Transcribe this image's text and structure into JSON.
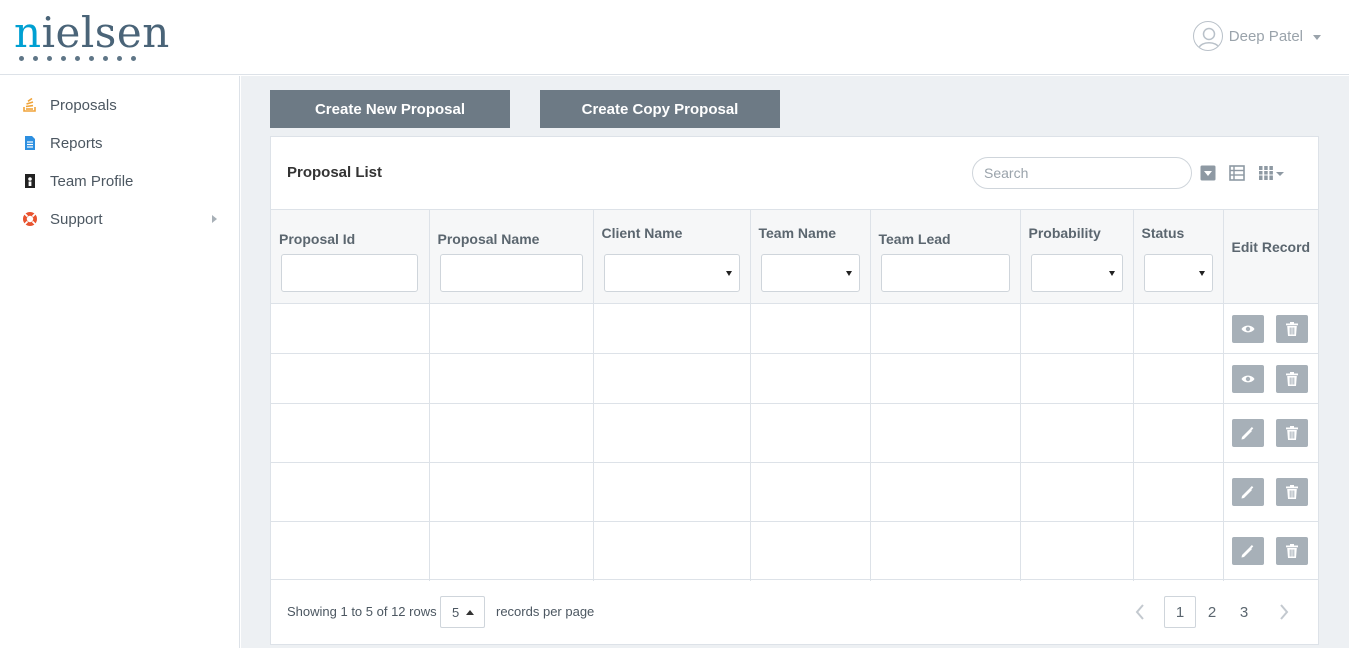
{
  "brand": {
    "logo_text": "nielsen"
  },
  "user": {
    "name": "Deep Patel"
  },
  "sidebar": {
    "items": [
      {
        "label": "Proposals",
        "icon": "stack-icon",
        "color": "#f0a43a"
      },
      {
        "label": "Reports",
        "icon": "document-icon",
        "color": "#2d8fe0"
      },
      {
        "label": "Team Profile",
        "icon": "id-badge-icon",
        "color": "#222222"
      },
      {
        "label": "Support",
        "icon": "lifebuoy-icon",
        "color": "#e8532f"
      }
    ]
  },
  "toolbar": {
    "create_new_label": "Create New Proposal",
    "create_copy_label": "Create Copy Proposal"
  },
  "panel": {
    "title": "Proposal List",
    "search_placeholder": "Search"
  },
  "table": {
    "columns": [
      {
        "label": "Proposal Id",
        "filter": "text"
      },
      {
        "label": "Proposal Name",
        "filter": "text"
      },
      {
        "label": "Client Name",
        "filter": "select"
      },
      {
        "label": "Team Name",
        "filter": "select"
      },
      {
        "label": "Team Lead",
        "filter": "text"
      },
      {
        "label": "Probability",
        "filter": "select"
      },
      {
        "label": "Status",
        "filter": "select"
      },
      {
        "label": "Edit Record",
        "filter": "none"
      }
    ],
    "rows": [
      {
        "action": "view"
      },
      {
        "action": "view"
      },
      {
        "action": "edit"
      },
      {
        "action": "edit"
      },
      {
        "action": "edit"
      }
    ]
  },
  "footer": {
    "showing_text": "Showing 1 to 5 of 12 rows",
    "per_page_value": "5",
    "per_page_suffix": "records per page",
    "pages": [
      "1",
      "2",
      "3"
    ],
    "current_page": "1"
  },
  "colors": {
    "button_bg": "#6d7a85",
    "main_bg": "#edf0f3",
    "action_btn": "#a7b0b8"
  }
}
